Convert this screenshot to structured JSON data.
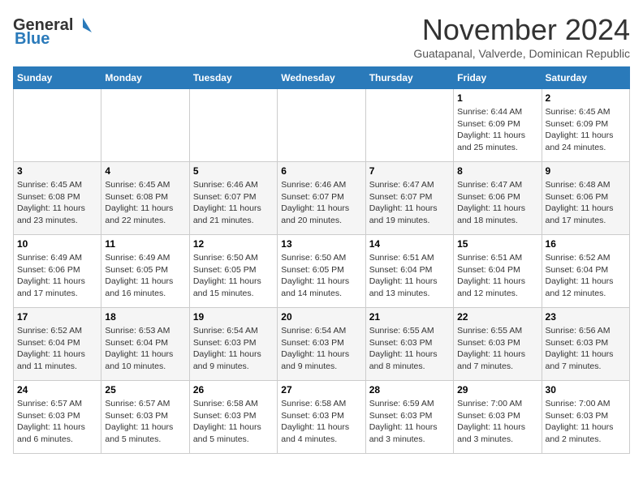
{
  "header": {
    "logo_line1": "General",
    "logo_line2": "Blue",
    "month": "November 2024",
    "location": "Guatapanal, Valverde, Dominican Republic"
  },
  "days_of_week": [
    "Sunday",
    "Monday",
    "Tuesday",
    "Wednesday",
    "Thursday",
    "Friday",
    "Saturday"
  ],
  "weeks": [
    [
      {
        "day": "",
        "info": ""
      },
      {
        "day": "",
        "info": ""
      },
      {
        "day": "",
        "info": ""
      },
      {
        "day": "",
        "info": ""
      },
      {
        "day": "",
        "info": ""
      },
      {
        "day": "1",
        "info": "Sunrise: 6:44 AM\nSunset: 6:09 PM\nDaylight: 11 hours\nand 25 minutes."
      },
      {
        "day": "2",
        "info": "Sunrise: 6:45 AM\nSunset: 6:09 PM\nDaylight: 11 hours\nand 24 minutes."
      }
    ],
    [
      {
        "day": "3",
        "info": "Sunrise: 6:45 AM\nSunset: 6:08 PM\nDaylight: 11 hours\nand 23 minutes."
      },
      {
        "day": "4",
        "info": "Sunrise: 6:45 AM\nSunset: 6:08 PM\nDaylight: 11 hours\nand 22 minutes."
      },
      {
        "day": "5",
        "info": "Sunrise: 6:46 AM\nSunset: 6:07 PM\nDaylight: 11 hours\nand 21 minutes."
      },
      {
        "day": "6",
        "info": "Sunrise: 6:46 AM\nSunset: 6:07 PM\nDaylight: 11 hours\nand 20 minutes."
      },
      {
        "day": "7",
        "info": "Sunrise: 6:47 AM\nSunset: 6:07 PM\nDaylight: 11 hours\nand 19 minutes."
      },
      {
        "day": "8",
        "info": "Sunrise: 6:47 AM\nSunset: 6:06 PM\nDaylight: 11 hours\nand 18 minutes."
      },
      {
        "day": "9",
        "info": "Sunrise: 6:48 AM\nSunset: 6:06 PM\nDaylight: 11 hours\nand 17 minutes."
      }
    ],
    [
      {
        "day": "10",
        "info": "Sunrise: 6:49 AM\nSunset: 6:06 PM\nDaylight: 11 hours\nand 17 minutes."
      },
      {
        "day": "11",
        "info": "Sunrise: 6:49 AM\nSunset: 6:05 PM\nDaylight: 11 hours\nand 16 minutes."
      },
      {
        "day": "12",
        "info": "Sunrise: 6:50 AM\nSunset: 6:05 PM\nDaylight: 11 hours\nand 15 minutes."
      },
      {
        "day": "13",
        "info": "Sunrise: 6:50 AM\nSunset: 6:05 PM\nDaylight: 11 hours\nand 14 minutes."
      },
      {
        "day": "14",
        "info": "Sunrise: 6:51 AM\nSunset: 6:04 PM\nDaylight: 11 hours\nand 13 minutes."
      },
      {
        "day": "15",
        "info": "Sunrise: 6:51 AM\nSunset: 6:04 PM\nDaylight: 11 hours\nand 12 minutes."
      },
      {
        "day": "16",
        "info": "Sunrise: 6:52 AM\nSunset: 6:04 PM\nDaylight: 11 hours\nand 12 minutes."
      }
    ],
    [
      {
        "day": "17",
        "info": "Sunrise: 6:52 AM\nSunset: 6:04 PM\nDaylight: 11 hours\nand 11 minutes."
      },
      {
        "day": "18",
        "info": "Sunrise: 6:53 AM\nSunset: 6:04 PM\nDaylight: 11 hours\nand 10 minutes."
      },
      {
        "day": "19",
        "info": "Sunrise: 6:54 AM\nSunset: 6:03 PM\nDaylight: 11 hours\nand 9 minutes."
      },
      {
        "day": "20",
        "info": "Sunrise: 6:54 AM\nSunset: 6:03 PM\nDaylight: 11 hours\nand 9 minutes."
      },
      {
        "day": "21",
        "info": "Sunrise: 6:55 AM\nSunset: 6:03 PM\nDaylight: 11 hours\nand 8 minutes."
      },
      {
        "day": "22",
        "info": "Sunrise: 6:55 AM\nSunset: 6:03 PM\nDaylight: 11 hours\nand 7 minutes."
      },
      {
        "day": "23",
        "info": "Sunrise: 6:56 AM\nSunset: 6:03 PM\nDaylight: 11 hours\nand 7 minutes."
      }
    ],
    [
      {
        "day": "24",
        "info": "Sunrise: 6:57 AM\nSunset: 6:03 PM\nDaylight: 11 hours\nand 6 minutes."
      },
      {
        "day": "25",
        "info": "Sunrise: 6:57 AM\nSunset: 6:03 PM\nDaylight: 11 hours\nand 5 minutes."
      },
      {
        "day": "26",
        "info": "Sunrise: 6:58 AM\nSunset: 6:03 PM\nDaylight: 11 hours\nand 5 minutes."
      },
      {
        "day": "27",
        "info": "Sunrise: 6:58 AM\nSunset: 6:03 PM\nDaylight: 11 hours\nand 4 minutes."
      },
      {
        "day": "28",
        "info": "Sunrise: 6:59 AM\nSunset: 6:03 PM\nDaylight: 11 hours\nand 3 minutes."
      },
      {
        "day": "29",
        "info": "Sunrise: 7:00 AM\nSunset: 6:03 PM\nDaylight: 11 hours\nand 3 minutes."
      },
      {
        "day": "30",
        "info": "Sunrise: 7:00 AM\nSunset: 6:03 PM\nDaylight: 11 hours\nand 2 minutes."
      }
    ]
  ]
}
